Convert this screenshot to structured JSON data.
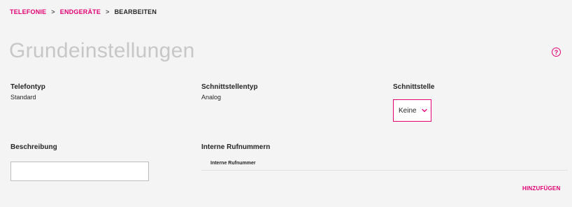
{
  "breadcrumb": {
    "items": [
      "TELEFONIE",
      "ENDGERÄTE"
    ],
    "separator": ">",
    "current": "BEARBEITEN"
  },
  "page": {
    "title": "Grundeinstellungen",
    "help_icon": "question-circle"
  },
  "fields": {
    "telefontyp": {
      "label": "Telefontyp",
      "value": "Standard"
    },
    "schnittstellentyp": {
      "label": "Schnittstellentyp",
      "value": "Analog"
    },
    "schnittstelle": {
      "label": "Schnittstelle",
      "selected": "Keine",
      "icon": "chevron-down"
    },
    "beschreibung": {
      "label": "Beschreibung",
      "value": ""
    }
  },
  "interne_rufnummern": {
    "label": "Interne Rufnummern",
    "columns": [
      "Interne Rufnummer"
    ],
    "rows": [],
    "add_label": "HINZUFÜGEN"
  },
  "colors": {
    "accent": "#e20074",
    "background": "#f4f4f4",
    "title": "#c7c7c7"
  }
}
